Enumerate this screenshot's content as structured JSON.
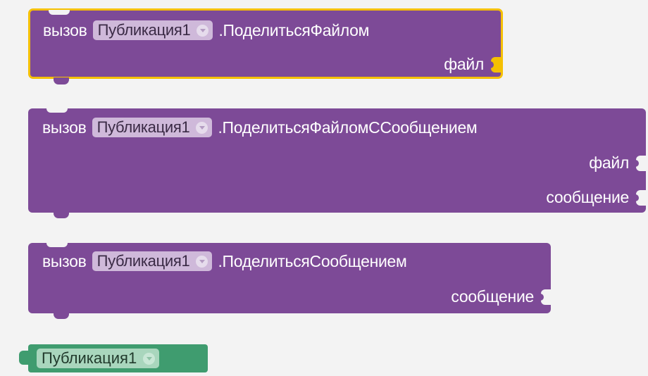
{
  "blocks": [
    {
      "keyword": "вызов",
      "component": "Публикация1",
      "method": ".ПоделитьсяФайлом",
      "params": [
        "файл"
      ],
      "selected": true
    },
    {
      "keyword": "вызов",
      "component": "Публикация1",
      "method": ".ПоделитьсяФайломССообщением",
      "params": [
        "файл",
        "сообщение"
      ],
      "selected": false
    },
    {
      "keyword": "вызов",
      "component": "Публикация1",
      "method": ".ПоделитьсяСообщением",
      "params": [
        "сообщение"
      ],
      "selected": false
    }
  ],
  "component_block": {
    "component": "Публикация1"
  },
  "colors": {
    "procedure_block": "#7d4a97",
    "component_block": "#3f9c6f",
    "selection_outline": "#f5c000",
    "workspace": "#f3f3f3"
  },
  "icons": {
    "dropdown": "chevron-down-icon",
    "input_socket": "value-socket-icon"
  }
}
